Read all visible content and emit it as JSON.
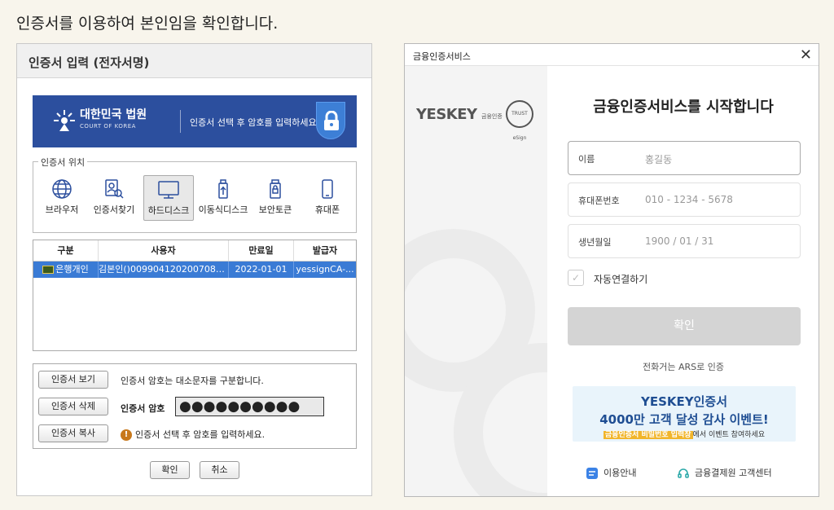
{
  "heading": "인증서를 이용하여 본인임을 확인합니다.",
  "left_dialog": {
    "title": "인증서 입력 (전자서명)",
    "banner": {
      "org_name": "대한민국 법원",
      "org_name_en": "COURT OF KOREA",
      "message": "인증서 선택 후 암호를 입력하세요."
    },
    "location_group": {
      "legend": "인증서 위치",
      "items": [
        {
          "label": "브라우저",
          "icon": "globe-icon"
        },
        {
          "label": "인증서찾기",
          "icon": "search-cert-icon"
        },
        {
          "label": "하드디스크",
          "icon": "monitor-icon",
          "selected": true
        },
        {
          "label": "이동식디스크",
          "icon": "usb-icon"
        },
        {
          "label": "보안토큰",
          "icon": "token-icon"
        },
        {
          "label": "휴대폰",
          "icon": "phone-icon"
        }
      ]
    },
    "cert_table": {
      "columns": [
        "구분",
        "사용자",
        "만료일",
        "발급자"
      ],
      "rows": [
        {
          "type": "은행개인",
          "user": "김본인()0099041202007080...",
          "expiry": "2022-01-01",
          "issuer": "yessignCA-..."
        }
      ]
    },
    "buttons": {
      "view": "인증서 보기",
      "delete": "인증서 삭제",
      "copy": "인증서 복사",
      "ok": "확인",
      "cancel": "취소"
    },
    "case_note": "인증서 암호는 대소문자를 구분합니다.",
    "password_label": "인증서 암호",
    "password_value": "●●●●●●●●●●",
    "hint": "인증서 선택 후 암호를 입력하세요."
  },
  "right_dialog": {
    "title": "금융인증서비스",
    "logo_text": "YESKEY",
    "logo_sub": "금융인증",
    "trust_text": "TRUST eSign",
    "heading": "금융인증서비스를 시작합니다",
    "fields": [
      {
        "label": "이름",
        "placeholder": "홍길동"
      },
      {
        "label": "휴대폰번호",
        "placeholder": "010 - 1234 - 5678"
      },
      {
        "label": "생년월일",
        "placeholder": "1900 / 01 / 31"
      }
    ],
    "auto_connect": "자동연결하기",
    "confirm": "확인",
    "ars": "전화거는 ARS로 인증",
    "promo": {
      "line1": "YESKEY인증서",
      "line2": "4000만 고객 달성 감사 이벤트!",
      "highlight": "금융인증서 비밀번호 입력창",
      "tail": "에서 이벤트 참여하세요"
    },
    "footer": {
      "guide": "이용안내",
      "support": "금융결제원 고객센터"
    }
  }
}
